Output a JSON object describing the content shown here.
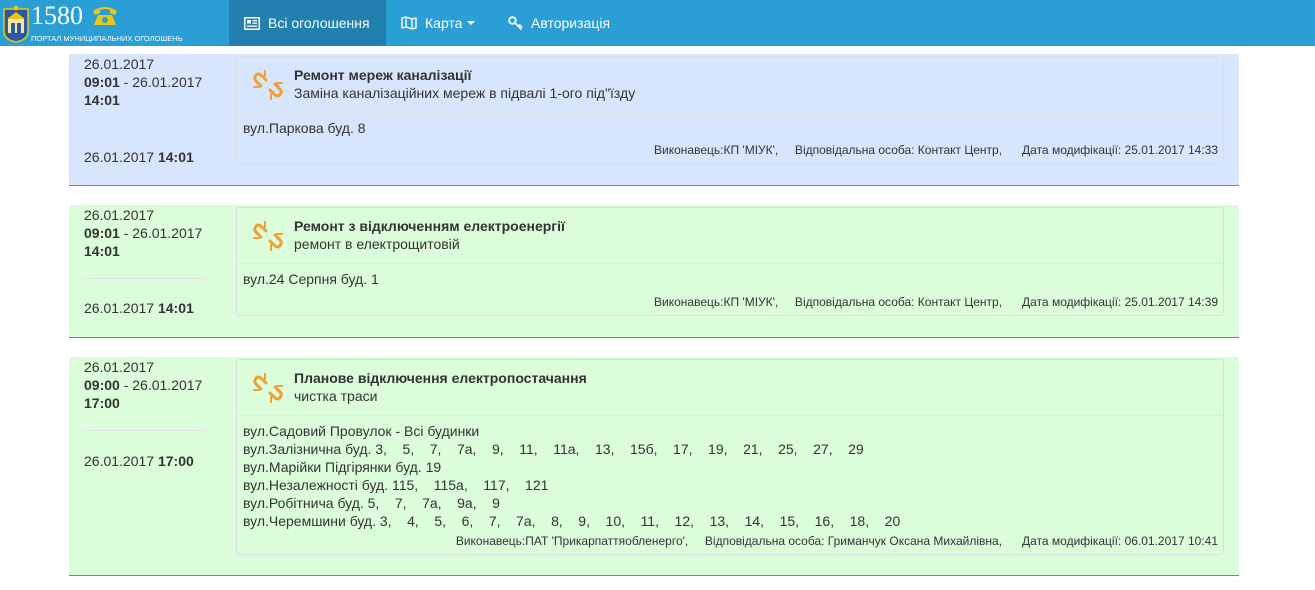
{
  "navbar": {
    "brand_number": "1580",
    "brand_subtitle": "ПОРТАЛ МУНИЦИПАЛЬНИХ ОГОЛОШЕНЬ",
    "items": [
      {
        "label": "Всі оголошення",
        "icon": "newspaper-icon"
      },
      {
        "label": "Карта",
        "icon": "map-icon"
      },
      {
        "label": "Авторизація",
        "icon": "key-icon"
      }
    ],
    "colors": {
      "bar": "#2a9fd6",
      "active": "#2180ad"
    }
  },
  "announcements": [
    {
      "color": "#d8e6fd",
      "start_date": "26.01.2017",
      "start_time": "09:01",
      "end_date": "26.01.2017",
      "end_time": "14:01",
      "mod_date": "26.01.2017",
      "mod_time": "14:01",
      "title": "Ремонт мереж каналізації",
      "subtitle": "Заміна каналізаційних мереж в підвалі 1-ого під\"їзду",
      "addresses": [
        "вул.Паркова буд. 8"
      ],
      "footer": "Виконавець:КП 'МІУК',     Відповідальна особа: Контакт Центр,      Дата модифікації: 25.01.2017 14:33"
    },
    {
      "color": "#dbfdd9",
      "start_date": "26.01.2017",
      "start_time": "09:01",
      "end_date": "26.01.2017",
      "end_time": "14:01",
      "mod_date": "26.01.2017",
      "mod_time": "14:01",
      "title": "Ремонт з відключенням електроенергії",
      "subtitle": "ремонт в електрощитовій",
      "addresses": [
        "вул.24 Серпня буд. 1"
      ],
      "footer": "Виконавець:КП 'МІУК',     Відповідальна особа: Контакт Центр,      Дата модифікації: 25.01.2017 14:39"
    },
    {
      "color": "#dbfdd9",
      "start_date": "26.01.2017",
      "start_time": "09:00",
      "end_date": "26.01.2017",
      "end_time": "17:00",
      "mod_date": "26.01.2017",
      "mod_time": "17:00",
      "title": "Планове відключення електропостачання",
      "subtitle": "чистка траси",
      "addresses": [
        "вул.Садовий Провулок - Всі будинки",
        "вул.Залізнична буд. 3,    5,    7,    7а,    9,    11,    11а,    13,    15б,    17,    19,    21,    25,    27,    29",
        "вул.Марійки Підгірянки буд. 19",
        "вул.Незалежності буд. 115,    115а,    117,    121",
        "вул.Робітнича буд. 5,    7,    7а,    9а,    9",
        "вул.Черемшини буд. 3,    4,    5,    6,    7,    7а,    8,    9,    10,    11,    12,    13,    14,    15,    16,    18,    20"
      ],
      "footer": "Виконавець:ПАТ 'Прикарпаттяобленерго',     Відповідальна особа: Гриманчук Оксана Михайлівна,      Дата модифікації: 06.01.2017 10:41"
    }
  ]
}
